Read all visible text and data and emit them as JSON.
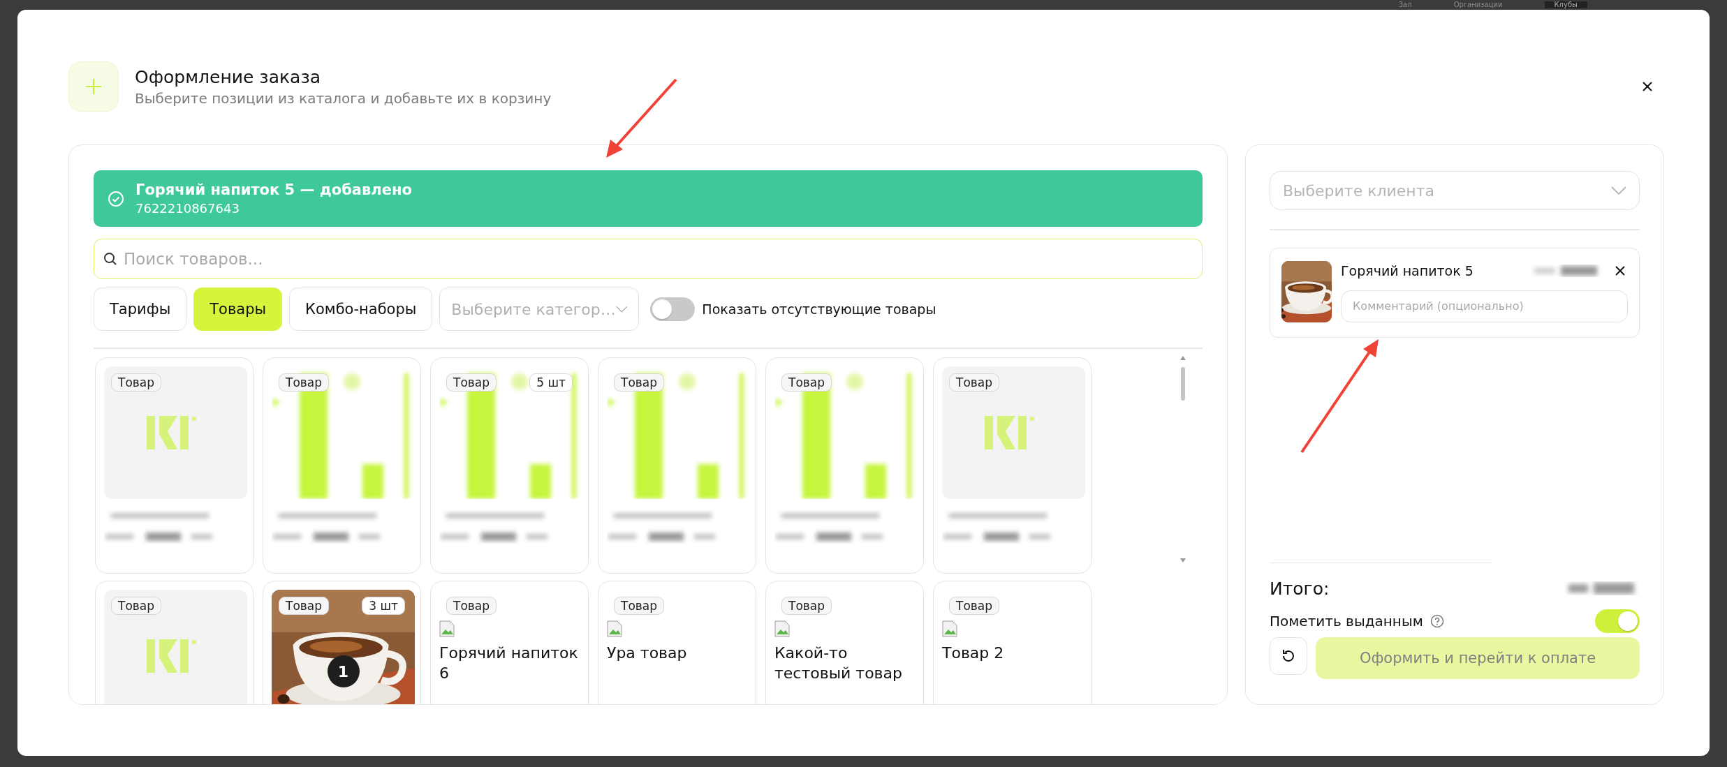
{
  "backdrop": {
    "items": [
      "Зал",
      "Организации",
      "Клубы"
    ]
  },
  "dialog": {
    "title": "Оформление заказа",
    "subtitle": "Выберите позиции из каталога и добавьте их в корзину"
  },
  "notification": {
    "title": "Горячий напиток 5 — добавлено",
    "code": "7622210867643"
  },
  "search": {
    "placeholder": "Поиск товаров..."
  },
  "tabs": [
    {
      "label": "Тарифы",
      "selected": false
    },
    {
      "label": "Товары",
      "selected": true
    },
    {
      "label": "Комбо-наборы",
      "selected": false
    }
  ],
  "category": {
    "placeholder": "Выберите категор…"
  },
  "show_missing": {
    "label": "Показать отсутствующие товары",
    "on": false
  },
  "products": [
    {
      "kind": "logo",
      "tag": "Товар"
    },
    {
      "kind": "blurred",
      "tag": "Товар"
    },
    {
      "kind": "blurred",
      "tag": "Товар",
      "count": "5 шт"
    },
    {
      "kind": "blurred",
      "tag": "Товар"
    },
    {
      "kind": "blurred",
      "tag": "Товар"
    },
    {
      "kind": "logo",
      "tag": "Товар"
    },
    {
      "kind": "logo",
      "tag": "Товар"
    },
    {
      "tag": "Товар",
      "count": "3 шт",
      "in_cart": "1"
    },
    {
      "kind": "broken",
      "tag": "Товар",
      "alt": "Горячий напиток 6"
    },
    {
      "kind": "broken",
      "tag": "Товар",
      "alt": "Ура товар"
    },
    {
      "kind": "broken",
      "tag": "Товар",
      "alt": "Какой-то тестовый товар"
    },
    {
      "kind": "broken",
      "tag": "Товар",
      "alt": "Товар 2"
    }
  ],
  "cart": {
    "client_placeholder": "Выберите клиента",
    "items": [
      {
        "name": "Горячий напиток 5",
        "comment_placeholder": "Комментарий (опционально)"
      }
    ],
    "total_label": "Итого:",
    "mark_issued": {
      "label": "Пометить выданным",
      "on": true
    },
    "submit": {
      "label": "Оформить и перейти к оплате",
      "disabled": true
    }
  }
}
